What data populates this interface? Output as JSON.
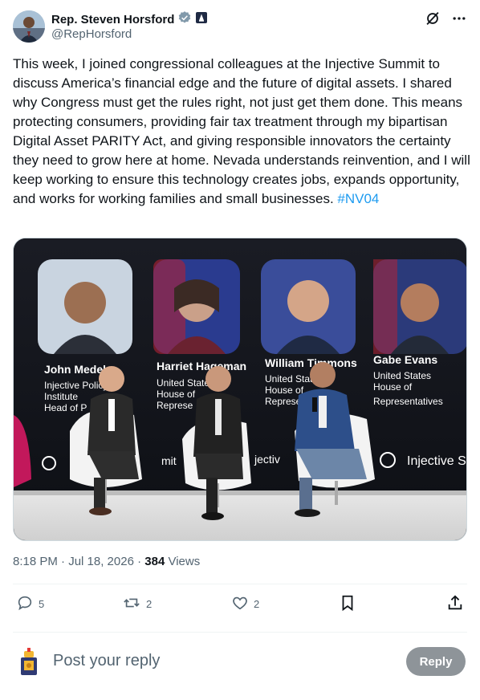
{
  "author": {
    "display_name": "Rep. Steven Horsford",
    "handle": "@RepHorsford",
    "verified_badge_icon": "verified-badge-icon",
    "affiliation_badge_icon": "government-badge-icon"
  },
  "header_actions": {
    "grok_icon": "grok-icon",
    "more_icon": "more-options-icon"
  },
  "post": {
    "text": "This week, I joined congressional colleagues at the Injective Summit to discuss America’s financial edge and the future of digital assets. I shared why Congress must get the rules right, not just get them done. This means protecting consumers, providing fair tax treatment through my bipartisan Digital Asset PARITY Act, and giving responsible innovators the certainty they need to grow here at home. Nevada understands reinvention, and I will keep working to ensure this technology creates jobs, expands opportunity, and works for working families and small businesses. ",
    "hashtag": "#NV04",
    "timestamp": "8:18 PM · Jul 18, 2026 · ",
    "views_count": "384",
    "views_label": " Views"
  },
  "media": {
    "screen_panels": [
      {
        "name": "John Medel",
        "line1": "Injective Policy",
        "line2": "Institute",
        "line3": "Head of P"
      },
      {
        "name": "Harriet Hageman",
        "line1": "United States",
        "line2": "House of",
        "line3": "Represe"
      },
      {
        "name": "William Timmons",
        "line1": "United States",
        "line2": "House of",
        "line3": "Represe"
      },
      {
        "name": "Gabe Evans",
        "line1": "United States",
        "line2": "House of",
        "line3": "Representatives"
      }
    ],
    "logo_text_right": "Injective S",
    "logo_text_mid1": "mit",
    "logo_text_mid2": "jectiv"
  },
  "actions": {
    "reply_count": "5",
    "repost_count": "2",
    "like_count": "2",
    "reply_icon": "reply-icon",
    "repost_icon": "repost-icon",
    "like_icon": "like-icon",
    "bookmark_icon": "bookmark-icon",
    "share_icon": "share-icon"
  },
  "reply_box": {
    "placeholder": "Post your reply",
    "button_label": "Reply"
  },
  "colors": {
    "link": "#1d9bf0",
    "secondary_text": "#536471",
    "reply_button_disabled": "#8e9499"
  }
}
